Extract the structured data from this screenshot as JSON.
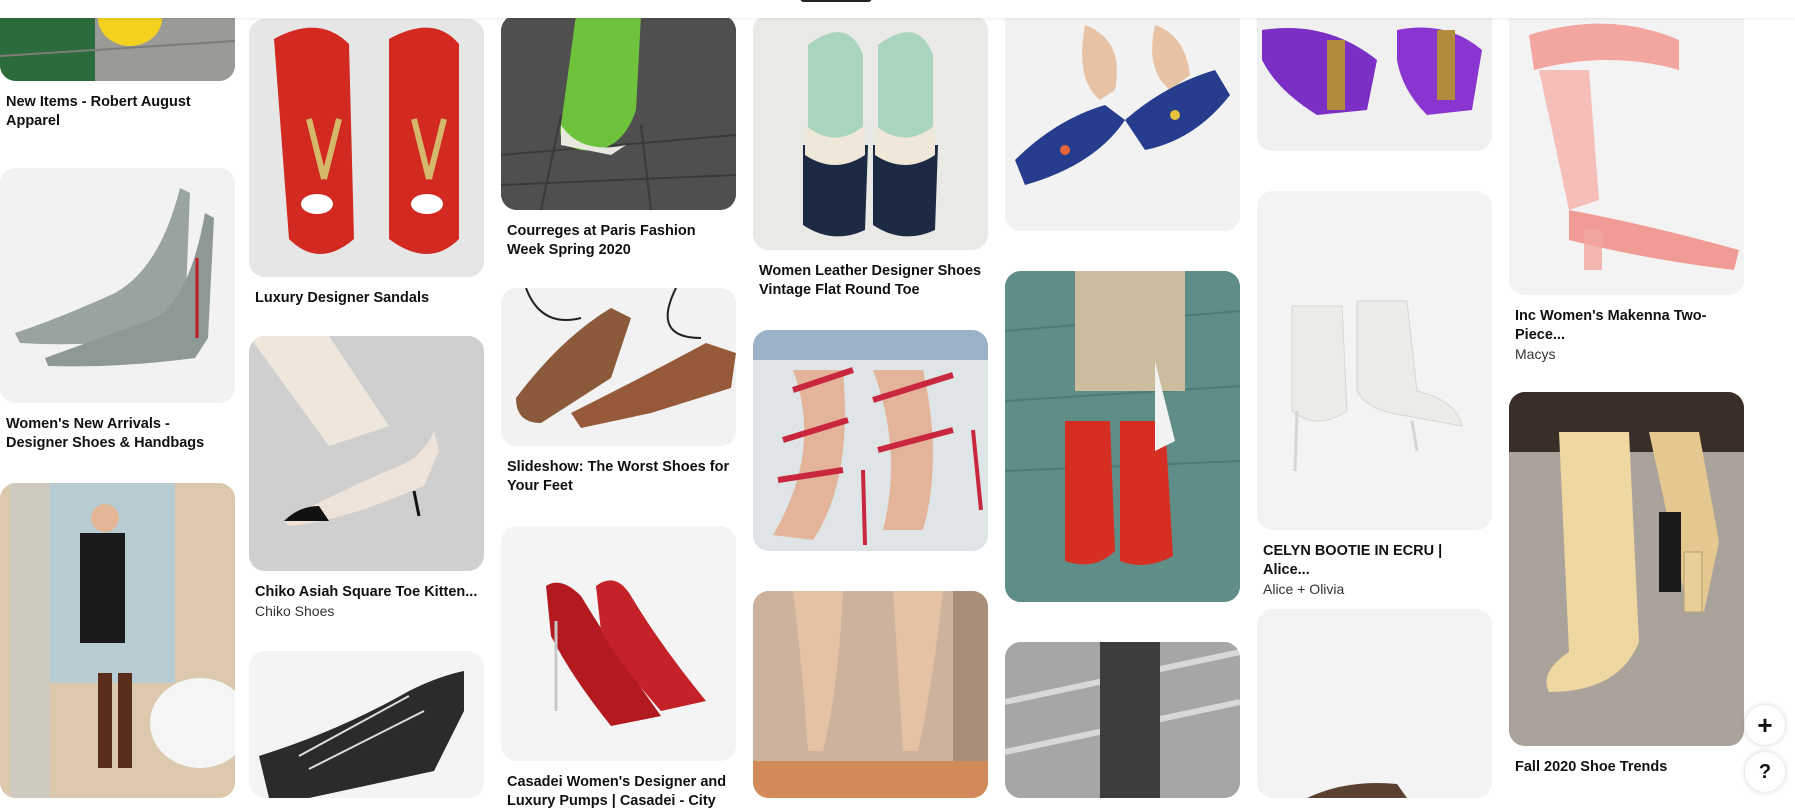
{
  "pins": {
    "robert_august": {
      "title": "New Items - Robert August Apparel"
    },
    "designer_shoes": {
      "title": "Women's New Arrivals - Designer Shoes & Handbags"
    },
    "ysl_sandals": {
      "title": "Luxury Designer Sandals"
    },
    "chiko": {
      "title": "Chiko Asiah Square Toe Kitten...",
      "source": "Chiko Shoes"
    },
    "courreges": {
      "title": "Courreges at Paris Fashion Week Spring 2020"
    },
    "slideshow": {
      "title": "Slideshow: The Worst Shoes for Your Feet"
    },
    "casadei": {
      "title": "Casadei Women's Designer and Luxury Pumps | Casadei - City"
    },
    "leather_shoes": {
      "title": "Women Leather Designer Shoes Vintage Flat Round Toe"
    },
    "celyn": {
      "title": "CELYN BOOTIE IN ECRU | Alice...",
      "source": "Alice + Olivia"
    },
    "makenna": {
      "title": "Inc Women's Makenna Two-Piece...",
      "source": "Macys"
    },
    "fall_trends": {
      "title": "Fall 2020 Shoe Trends"
    }
  },
  "floating": {
    "add_label": "+",
    "help_label": "?"
  },
  "icons": [
    "add-icon",
    "help-icon"
  ],
  "colors": {
    "background": "#ffffff",
    "card": "#efefef",
    "text": "#111111"
  }
}
